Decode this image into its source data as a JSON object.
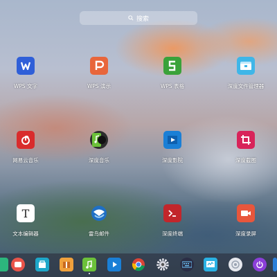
{
  "search": {
    "placeholder": "搜索",
    "icon": "search-icon"
  },
  "apps": [
    {
      "label": "WPS 文字",
      "icon": "wps-writer-icon",
      "color": "#2f5fd8"
    },
    {
      "label": "WPS 演示",
      "icon": "wps-presentation-icon",
      "color": "#e8663b"
    },
    {
      "label": "WPS 表格",
      "icon": "wps-spreadsheet-icon",
      "color": "#3aa23a"
    },
    {
      "label": "深度文件管理器",
      "icon": "file-manager-icon",
      "color": "#3fb6e8"
    },
    {
      "label": "网易云音乐",
      "icon": "netease-music-icon",
      "color": "#d92c2c"
    },
    {
      "label": "深度音乐",
      "icon": "deepin-music-icon",
      "color": "#2d2d2d"
    },
    {
      "label": "深度影院",
      "icon": "deepin-movie-icon",
      "color": "#1a7fd6"
    },
    {
      "label": "深度截图",
      "icon": "screenshot-icon",
      "color": "#d8245a"
    },
    {
      "label": "文本编辑器",
      "icon": "text-editor-icon",
      "color": "#ffffff"
    },
    {
      "label": "雷鸟邮件",
      "icon": "thunderbird-icon",
      "color": "#1f6fc4"
    },
    {
      "label": "深度终端",
      "icon": "terminal-icon",
      "color": "#c2262b"
    },
    {
      "label": "深度录屏",
      "icon": "screen-recorder-icon",
      "color": "#e8563c"
    }
  ],
  "dock": [
    {
      "icon": "green-app-icon"
    },
    {
      "icon": "launcher-red-icon"
    },
    {
      "icon": "app-store-icon"
    },
    {
      "icon": "wps-box-icon"
    },
    {
      "icon": "music-dock-icon"
    },
    {
      "icon": "movie-dock-icon"
    },
    {
      "icon": "chrome-icon"
    },
    {
      "icon": "settings-gear-icon"
    },
    {
      "icon": "keyboard-icon"
    },
    {
      "icon": "system-monitor-icon"
    },
    {
      "icon": "dde-icon"
    },
    {
      "icon": "power-icon"
    },
    {
      "icon": "overflow-icon"
    }
  ]
}
